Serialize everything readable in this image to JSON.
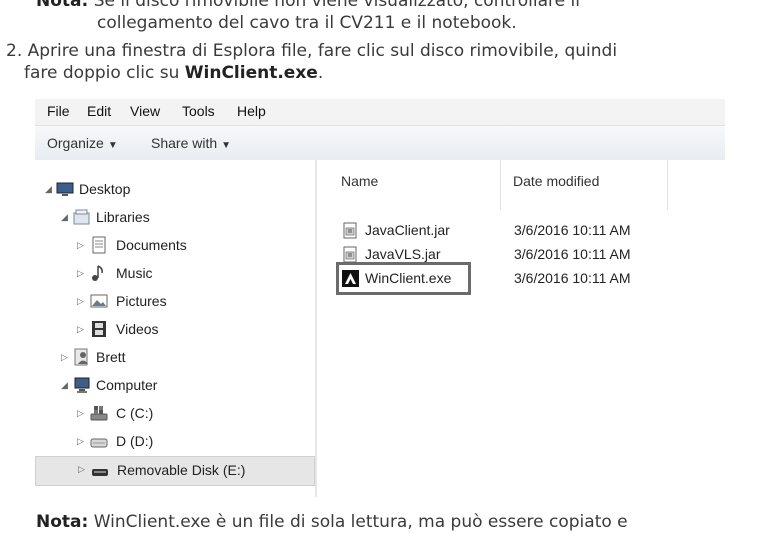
{
  "doc": {
    "note_top": {
      "label": "Nota:",
      "line1": " Se il disco rimovibile non viene visualizzato, controllare il",
      "line2": "collegamento del cavo tra il CV211 e il notebook."
    },
    "step2": {
      "line1": "2. Aprire una finestra di Esplora file, fare clic sul disco rimovibile, quindi",
      "line2_pre": "fare doppio clic su ",
      "line2_bold": "WinClient.exe",
      "line2_post": "."
    },
    "note_bottom": {
      "label": "Nota:",
      "text": " WinClient.exe è un file di sola lettura, ma può essere copiato e"
    }
  },
  "explorer": {
    "menu": [
      "File",
      "Edit",
      "View",
      "Tools",
      "Help"
    ],
    "toolbar": {
      "organize": "Organize",
      "share_with": "Share with"
    },
    "tree": [
      {
        "label": "Desktop",
        "icon": "desktop-icon",
        "expanded": true
      },
      {
        "label": "Libraries",
        "icon": "libraries-icon",
        "expanded": true
      },
      {
        "label": "Documents",
        "icon": "documents-icon",
        "expanded": false
      },
      {
        "label": "Music",
        "icon": "music-icon",
        "expanded": false
      },
      {
        "label": "Pictures",
        "icon": "pictures-icon",
        "expanded": false
      },
      {
        "label": "Videos",
        "icon": "videos-icon",
        "expanded": false
      },
      {
        "label": "Brett",
        "icon": "user-icon",
        "expanded": false
      },
      {
        "label": "Computer",
        "icon": "computer-icon",
        "expanded": true
      },
      {
        "label": "C (C:)",
        "icon": "drive-c-icon",
        "expanded": false
      },
      {
        "label": "D (D:)",
        "icon": "drive-icon",
        "expanded": false
      },
      {
        "label": "Removable Disk (E:)",
        "icon": "removable-disk-icon",
        "expanded": false,
        "selected": true
      }
    ],
    "columns": {
      "name": "Name",
      "date": "Date modified"
    },
    "files": [
      {
        "name": "JavaClient.jar",
        "date": "3/6/2016 10:11 AM",
        "icon": "jar-file-icon"
      },
      {
        "name": "JavaVLS.jar",
        "date": "3/6/2016 10:11 AM",
        "icon": "jar-file-icon"
      },
      {
        "name": "WinClient.exe",
        "date": "3/6/2016 10:11 AM",
        "icon": "exe-app-icon",
        "highlighted": true
      }
    ]
  }
}
